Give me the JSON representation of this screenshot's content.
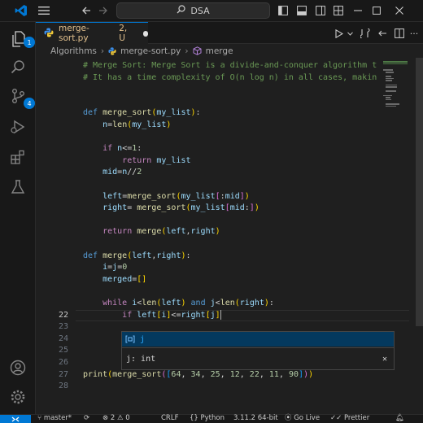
{
  "titlebar": {
    "search_text": "DSA",
    "colors": {
      "background": "#181818",
      "vscode_logo": "#0078d4"
    }
  },
  "activity": {
    "explorer_badge": "1",
    "scm_badge": "4",
    "icons": [
      "files-icon",
      "search-icon",
      "source-control-icon",
      "run-debug-icon",
      "extensions-icon",
      "testing-icon",
      "account-icon",
      "settings-gear-icon"
    ]
  },
  "tab": {
    "filename": "merge-sort.py",
    "status": "2, U",
    "language_glyph": "py"
  },
  "breadcrumb": {
    "folder": "Algorithms",
    "file": "merge-sort.py",
    "symbol": "merge"
  },
  "editor": {
    "lines": [
      {
        "n": "",
        "parts": [
          [
            "cm",
            "# Merge Sort: Merge Sort is a divide-and-conquer algorithm t"
          ]
        ]
      },
      {
        "n": "",
        "parts": [
          [
            "cm",
            "# It has a time complexity of O(n log n) in all cases, makin"
          ]
        ]
      },
      {
        "n": "",
        "parts": []
      },
      {
        "n": "",
        "parts": []
      },
      {
        "n": "",
        "parts": [
          [
            "kw",
            "def "
          ],
          [
            "fn",
            "merge_sort"
          ],
          [
            "br1",
            "("
          ],
          [
            "var",
            "my_list"
          ],
          [
            "br1",
            ")"
          ],
          [
            "plain",
            ":"
          ]
        ]
      },
      {
        "n": "",
        "parts": [
          [
            "plain",
            "    "
          ],
          [
            "var",
            "n"
          ],
          [
            "op",
            "="
          ],
          [
            "fn",
            "len"
          ],
          [
            "br1",
            "("
          ],
          [
            "var",
            "my_list"
          ],
          [
            "br1",
            ")"
          ]
        ]
      },
      {
        "n": "",
        "parts": []
      },
      {
        "n": "",
        "parts": [
          [
            "plain",
            "    "
          ],
          [
            "ctl",
            "if "
          ],
          [
            "var",
            "n"
          ],
          [
            "op",
            "<="
          ],
          [
            "num",
            "1"
          ],
          [
            "plain",
            ":"
          ]
        ]
      },
      {
        "n": "",
        "parts": [
          [
            "plain",
            "        "
          ],
          [
            "ctl",
            "return "
          ],
          [
            "var",
            "my_list"
          ]
        ]
      },
      {
        "n": "",
        "parts": [
          [
            "plain",
            "    "
          ],
          [
            "var",
            "mid"
          ],
          [
            "op",
            "="
          ],
          [
            "var",
            "n"
          ],
          [
            "op",
            "//"
          ],
          [
            "num",
            "2"
          ]
        ]
      },
      {
        "n": "",
        "parts": []
      },
      {
        "n": "",
        "parts": [
          [
            "plain",
            "    "
          ],
          [
            "var",
            "left"
          ],
          [
            "op",
            "="
          ],
          [
            "fn",
            "merge_sort"
          ],
          [
            "br1",
            "("
          ],
          [
            "var",
            "my_list"
          ],
          [
            "br2",
            "["
          ],
          [
            "op",
            ":"
          ],
          [
            "var",
            "mid"
          ],
          [
            "br2",
            "]"
          ],
          [
            "br1",
            ")"
          ]
        ]
      },
      {
        "n": "",
        "parts": [
          [
            "plain",
            "    "
          ],
          [
            "var",
            "right"
          ],
          [
            "op",
            "= "
          ],
          [
            "fn",
            "merge_sort"
          ],
          [
            "br1",
            "("
          ],
          [
            "var",
            "my_list"
          ],
          [
            "br2",
            "["
          ],
          [
            "var",
            "mid"
          ],
          [
            "op",
            ":"
          ],
          [
            "br2",
            "]"
          ],
          [
            "br1",
            ")"
          ]
        ]
      },
      {
        "n": "",
        "parts": []
      },
      {
        "n": "",
        "parts": [
          [
            "plain",
            "    "
          ],
          [
            "ctl",
            "return "
          ],
          [
            "fn",
            "merge"
          ],
          [
            "br1",
            "("
          ],
          [
            "var",
            "left"
          ],
          [
            "plain",
            ","
          ],
          [
            "var",
            "right"
          ],
          [
            "br1",
            ")"
          ]
        ]
      },
      {
        "n": "",
        "parts": []
      },
      {
        "n": "",
        "parts": [
          [
            "kw",
            "def "
          ],
          [
            "fn",
            "merge"
          ],
          [
            "br1",
            "("
          ],
          [
            "var",
            "left"
          ],
          [
            "plain",
            ","
          ],
          [
            "var",
            "right"
          ],
          [
            "br1",
            ")"
          ],
          [
            "plain",
            ":"
          ]
        ]
      },
      {
        "n": "",
        "parts": [
          [
            "plain",
            "    "
          ],
          [
            "var",
            "i"
          ],
          [
            "op",
            "="
          ],
          [
            "var",
            "j"
          ],
          [
            "op",
            "="
          ],
          [
            "num",
            "0"
          ]
        ]
      },
      {
        "n": "",
        "parts": [
          [
            "plain",
            "    "
          ],
          [
            "var",
            "merged"
          ],
          [
            "op",
            "="
          ],
          [
            "br1",
            "[]"
          ]
        ]
      },
      {
        "n": "",
        "parts": []
      },
      {
        "n": "",
        "parts": [
          [
            "plain",
            "    "
          ],
          [
            "ctl",
            "while "
          ],
          [
            "var",
            "i"
          ],
          [
            "op",
            "<"
          ],
          [
            "fn",
            "len"
          ],
          [
            "br1",
            "("
          ],
          [
            "var",
            "left"
          ],
          [
            "br1",
            ")"
          ],
          [
            "plain",
            " "
          ],
          [
            "kw",
            "and "
          ],
          [
            "var",
            "j"
          ],
          [
            "op",
            "<"
          ],
          [
            "fn",
            "len"
          ],
          [
            "br1",
            "("
          ],
          [
            "var",
            "right"
          ],
          [
            "br1",
            ")"
          ],
          [
            "plain",
            ":"
          ]
        ]
      },
      {
        "n": "",
        "parts": [
          [
            "plain",
            "        "
          ],
          [
            "ctl",
            "if "
          ],
          [
            "var",
            "left"
          ],
          [
            "br1",
            "["
          ],
          [
            "var",
            "i"
          ],
          [
            "br1",
            "]"
          ],
          [
            "op",
            "<="
          ],
          [
            "var",
            "right"
          ],
          [
            "br1",
            "["
          ],
          [
            "var",
            "j"
          ],
          [
            "br1",
            "]"
          ]
        ]
      },
      {
        "n": "",
        "parts": []
      },
      {
        "n": "",
        "parts": []
      },
      {
        "n": "",
        "parts": []
      },
      {
        "n": "",
        "parts": []
      },
      {
        "n": "",
        "parts": [
          [
            "fn",
            "print"
          ],
          [
            "br1",
            "("
          ],
          [
            "fn",
            "merge_sort"
          ],
          [
            "br2",
            "("
          ],
          [
            "br3",
            "["
          ],
          [
            "num",
            "64"
          ],
          [
            "plain",
            ", "
          ],
          [
            "num",
            "34"
          ],
          [
            "plain",
            ", "
          ],
          [
            "num",
            "25"
          ],
          [
            "plain",
            ", "
          ],
          [
            "num",
            "12"
          ],
          [
            "plain",
            ", "
          ],
          [
            "num",
            "22"
          ],
          [
            "plain",
            ", "
          ],
          [
            "num",
            "11"
          ],
          [
            "plain",
            ", "
          ],
          [
            "num",
            "90"
          ],
          [
            "br3",
            "]"
          ],
          [
            "br2",
            ")"
          ],
          [
            "br1",
            ")"
          ]
        ]
      },
      {
        "n": "",
        "parts": []
      }
    ],
    "visible_line_numbers": {
      "21": "22",
      "22": "23",
      "23": "24",
      "24": "25",
      "25": "26",
      "26": "27",
      "27": "28"
    },
    "active_line_index": 21
  },
  "suggest": {
    "item_label": "j",
    "detail": "j: int",
    "close_glyph": "✕"
  },
  "status": {
    "branch": "master*",
    "problems": "2",
    "warnings": "0",
    "line_ending": "CRLF",
    "language": "Python",
    "interpreter": "3.11.2 64-bit",
    "golive": "Go Live",
    "prettier": "Prettier"
  }
}
